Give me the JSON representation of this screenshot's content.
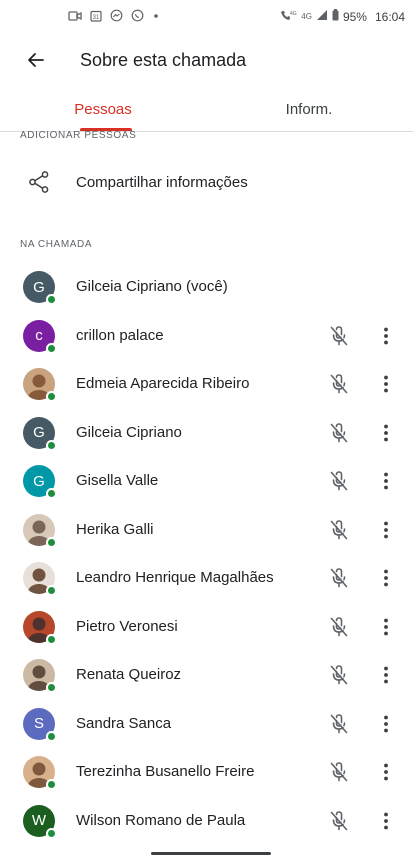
{
  "status_bar": {
    "battery": "95%",
    "time": "16:04",
    "network": "4G",
    "network_small": "4G"
  },
  "app_bar": {
    "title": "Sobre esta chamada",
    "back_icon": "arrow-back-icon"
  },
  "tabs": [
    {
      "label": "Pessoas",
      "selected": true
    },
    {
      "label": "Inform.",
      "selected": false
    }
  ],
  "sections": {
    "add_people": "ADICIONAR PESSOAS",
    "in_call": "NA CHAMADA"
  },
  "share": {
    "label": "Compartilhar informações",
    "icon": "share-icon"
  },
  "participants": [
    {
      "name": "Gilceia Cipriano (você)",
      "avatar": "initial",
      "initial": "G",
      "color": "#455a64",
      "muted_icon": false,
      "menu": false
    },
    {
      "name": "crillon palace",
      "avatar": "initial",
      "initial": "c",
      "color": "#7b1fa2",
      "muted_icon": true,
      "menu": true
    },
    {
      "name": "Edmeia Aparecida Ribeiro",
      "avatar": "photo",
      "photo_colors": [
        "#c9a27e",
        "#7a4e2e"
      ],
      "muted_icon": true,
      "menu": true
    },
    {
      "name": "Gilceia Cipriano",
      "avatar": "initial",
      "initial": "G",
      "color": "#455a64",
      "muted_icon": true,
      "menu": true
    },
    {
      "name": "Gisella Valle",
      "avatar": "initial",
      "initial": "G",
      "color": "#0097a7",
      "muted_icon": true,
      "menu": true
    },
    {
      "name": "Herika Galli",
      "avatar": "photo",
      "photo_colors": [
        "#d8c8b8",
        "#6b5346"
      ],
      "muted_icon": true,
      "menu": true
    },
    {
      "name": "Leandro Henrique Magalhães",
      "avatar": "photo",
      "photo_colors": [
        "#e8e0d8",
        "#5b3a26"
      ],
      "muted_icon": true,
      "menu": true
    },
    {
      "name": "Pietro Veronesi",
      "avatar": "photo",
      "photo_colors": [
        "#b7472a",
        "#3b2f2f"
      ],
      "muted_icon": true,
      "menu": true
    },
    {
      "name": "Renata Queiroz",
      "avatar": "photo",
      "photo_colors": [
        "#cbb9a4",
        "#4f3b2e"
      ],
      "muted_icon": true,
      "menu": true
    },
    {
      "name": "Sandra Sanca",
      "avatar": "initial",
      "initial": "S",
      "color": "#5c6bc0",
      "muted_icon": true,
      "menu": true
    },
    {
      "name": "Terezinha Busanello Freire",
      "avatar": "photo",
      "photo_colors": [
        "#d9b08c",
        "#6e4a2f"
      ],
      "muted_icon": true,
      "menu": true
    },
    {
      "name": "Wilson Romano de Paula",
      "avatar": "initial",
      "initial": "W",
      "color": "#1b5e20",
      "muted_icon": true,
      "menu": true
    }
  ],
  "colors": {
    "accent": "#d93025",
    "online": "#1e8e3e"
  }
}
